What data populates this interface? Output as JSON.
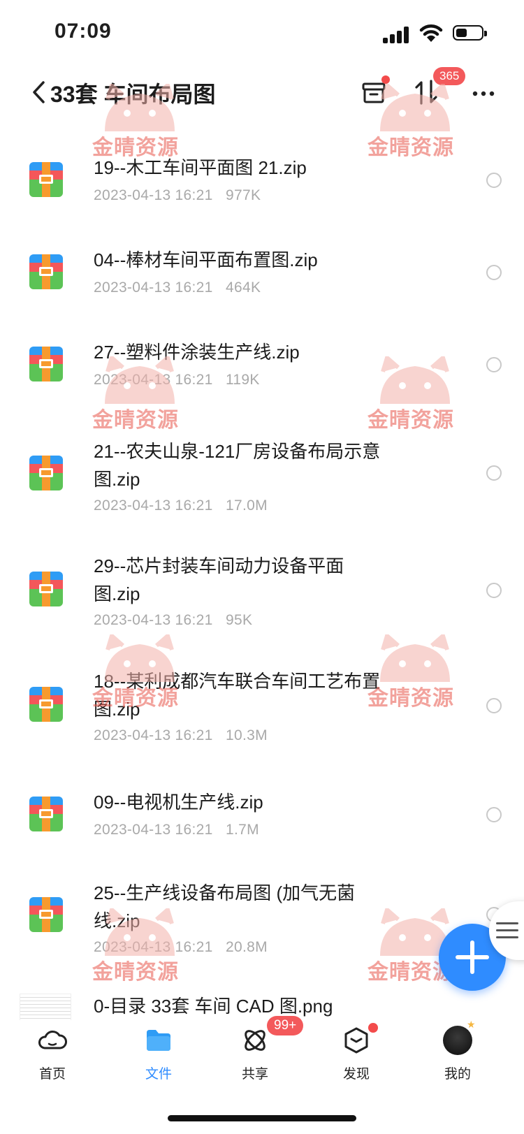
{
  "status_bar": {
    "time": "07:09"
  },
  "header": {
    "title": "33套 车间布局图",
    "transfer_badge": "365"
  },
  "files": [
    {
      "name": "19--木工车间平面图 21.zip",
      "date": "2023-04-13 16:21",
      "size": "977K",
      "type": "zip"
    },
    {
      "name": "04--棒材车间平面布置图.zip",
      "date": "2023-04-13 16:21",
      "size": "464K",
      "type": "zip"
    },
    {
      "name": "27--塑料件涂装生产线.zip",
      "date": "2023-04-13 16:21",
      "size": "119K",
      "type": "zip"
    },
    {
      "name": "21--农夫山泉-121厂房设备布局示意图.zip",
      "date": "2023-04-13 16:21",
      "size": "17.0M",
      "type": "zip"
    },
    {
      "name": "29--芯片封装车间动力设备平面图.zip",
      "date": "2023-04-13 16:21",
      "size": "95K",
      "type": "zip"
    },
    {
      "name": "18--某利成都汽车联合车间工艺布置图.zip",
      "date": "2023-04-13 16:21",
      "size": "10.3M",
      "type": "zip"
    },
    {
      "name": "09--电视机生产线.zip",
      "date": "2023-04-13 16:21",
      "size": "1.7M",
      "type": "zip"
    },
    {
      "name": "25--生产线设备布局图 (加气无菌线.zip",
      "date": "2023-04-13 16:21",
      "size": "20.8M",
      "type": "zip"
    },
    {
      "name": "0-目录 33套 车间 CAD 图.png",
      "date": "",
      "size": "",
      "type": "png"
    }
  ],
  "watermark_text": "金晴资源",
  "tabs": [
    {
      "label": "首页",
      "icon": "cloud-icon"
    },
    {
      "label": "文件",
      "icon": "folder-icon"
    },
    {
      "label": "共享",
      "icon": "share-orbit-icon",
      "badge": "99+"
    },
    {
      "label": "发现",
      "icon": "discover-box-icon"
    },
    {
      "label": "我的",
      "icon": "avatar-icon"
    }
  ],
  "colors": {
    "accent": "#2f8cff",
    "badge_red": "#f3595b",
    "meta_gray": "#a9a9a9",
    "watermark": "#e8574c"
  }
}
